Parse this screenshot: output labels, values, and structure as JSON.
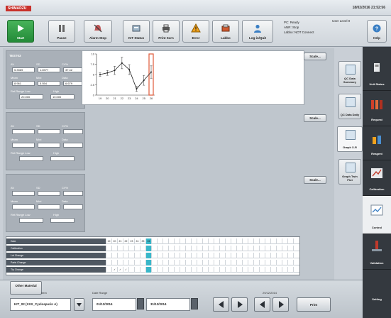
{
  "header": {
    "logo": "SHIMADZU",
    "datetime": "18/02/2016 21:52:56"
  },
  "toolbar": {
    "buttons": [
      {
        "label": "Start"
      },
      {
        "label": "Pause"
      },
      {
        "label": "Alarm Stop"
      },
      {
        "label": "KIT Status"
      },
      {
        "label": "Print Scrn"
      },
      {
        "label": "Error"
      },
      {
        "label": "Labbo"
      },
      {
        "label": "Log-in/Quit"
      },
      {
        "label": "Help"
      }
    ],
    "status": {
      "line1": "PC: Ready",
      "line2": "ANR: Stop",
      "line3": "Labbo: NOT Connect"
    },
    "user_level": "User Level 0"
  },
  "panels": [
    {
      "title": "TEST03",
      "labels": {
        "avg": "AV",
        "sd": "SD",
        "cv": "CV%",
        "mean": "Mean",
        "mini": "Mini",
        "data": "Data",
        "ref_low": "Ref.Range Low",
        "high": "High"
      },
      "values": {
        "av": "5.3369",
        "sd": "1.6977",
        "cv": "37.42",
        "mean": "8.961",
        "mini": "5.554",
        "data": "6.679",
        "ref_low": "20.000",
        "high": "10.000"
      }
    },
    {
      "title": "",
      "labels": {
        "avg": "AV",
        "sd": "SD",
        "cv": "CV%",
        "mean": "Mean",
        "mini": "Mini",
        "data": "Data",
        "ref_low": "Ref.Range Low",
        "high": "High"
      },
      "values": {
        "av": "",
        "sd": "",
        "cv": "",
        "mean": "",
        "mini": "",
        "data": "",
        "ref_low": "",
        "high": ""
      }
    },
    {
      "title": "",
      "labels": {
        "avg": "AV",
        "sd": "SD",
        "cv": "CV%",
        "mean": "Mean",
        "mini": "Mini",
        "data": "Data",
        "ref_low": "Ref.Range Low",
        "high": "High"
      },
      "values": {
        "av": "",
        "sd": "",
        "cv": "",
        "mean": "",
        "mini": "",
        "data": "",
        "ref_low": "",
        "high": ""
      }
    }
  ],
  "scale_label": "Scale...",
  "chart_data": {
    "type": "line",
    "x": [
      19,
      20,
      21,
      22,
      23,
      24,
      25,
      26
    ],
    "y": [
      5.0,
      5.4,
      6.0,
      7.8,
      6.2,
      1.5,
      3.6,
      5.6
    ],
    "yerr": [
      0.4,
      0.6,
      1.0,
      1.4,
      1.2,
      0.6,
      1.2,
      1.5
    ],
    "ylim": [
      0,
      10
    ],
    "yticks": [
      "10",
      "7.5",
      "5",
      "2.5",
      "0"
    ],
    "xticks": [
      "19",
      "20",
      "21",
      "22",
      "23",
      "24",
      "25",
      "26"
    ],
    "highlight_x": 26,
    "highlight_color": "#e05a3a",
    "line_color": "#222222"
  },
  "graph_tabs": [
    "QC Data Summary",
    "QC Data Daily",
    "Graph X-R",
    "Graph Twin Plot"
  ],
  "sidebar": {
    "items": [
      {
        "label": "Unit Status",
        "icon": "unit-status-icon"
      },
      {
        "label": "Request",
        "icon": "request-icon"
      },
      {
        "label": "Reagent",
        "icon": "reagent-icon"
      },
      {
        "label": "Calibration",
        "icon": "calibration-icon"
      },
      {
        "label": "Control",
        "icon": "control-icon"
      },
      {
        "label": "Validation",
        "icon": "validation-icon"
      },
      {
        "label": "Setting",
        "icon": "setting-icon"
      }
    ]
  },
  "lot_table": {
    "rows": [
      "Date",
      "Calibration",
      "Lot Change",
      "Parts Change",
      "Tip Change"
    ],
    "days": [
      "19",
      "20",
      "21",
      "22",
      "23",
      "24",
      "25",
      "26"
    ],
    "highlight_index": 7,
    "tip_marks": [
      "✓",
      "✓",
      "✓"
    ]
  },
  "bottom": {
    "other_material": "Other Material",
    "item_label": "Item",
    "item_value": "KIT_02 (XXX_Cyclosporin A)",
    "date_range_label": "Date Range",
    "date_from": "01/12/2014",
    "date_to": "31/12/2014",
    "nav_date": "29/12/2014",
    "print_label": "Print"
  }
}
